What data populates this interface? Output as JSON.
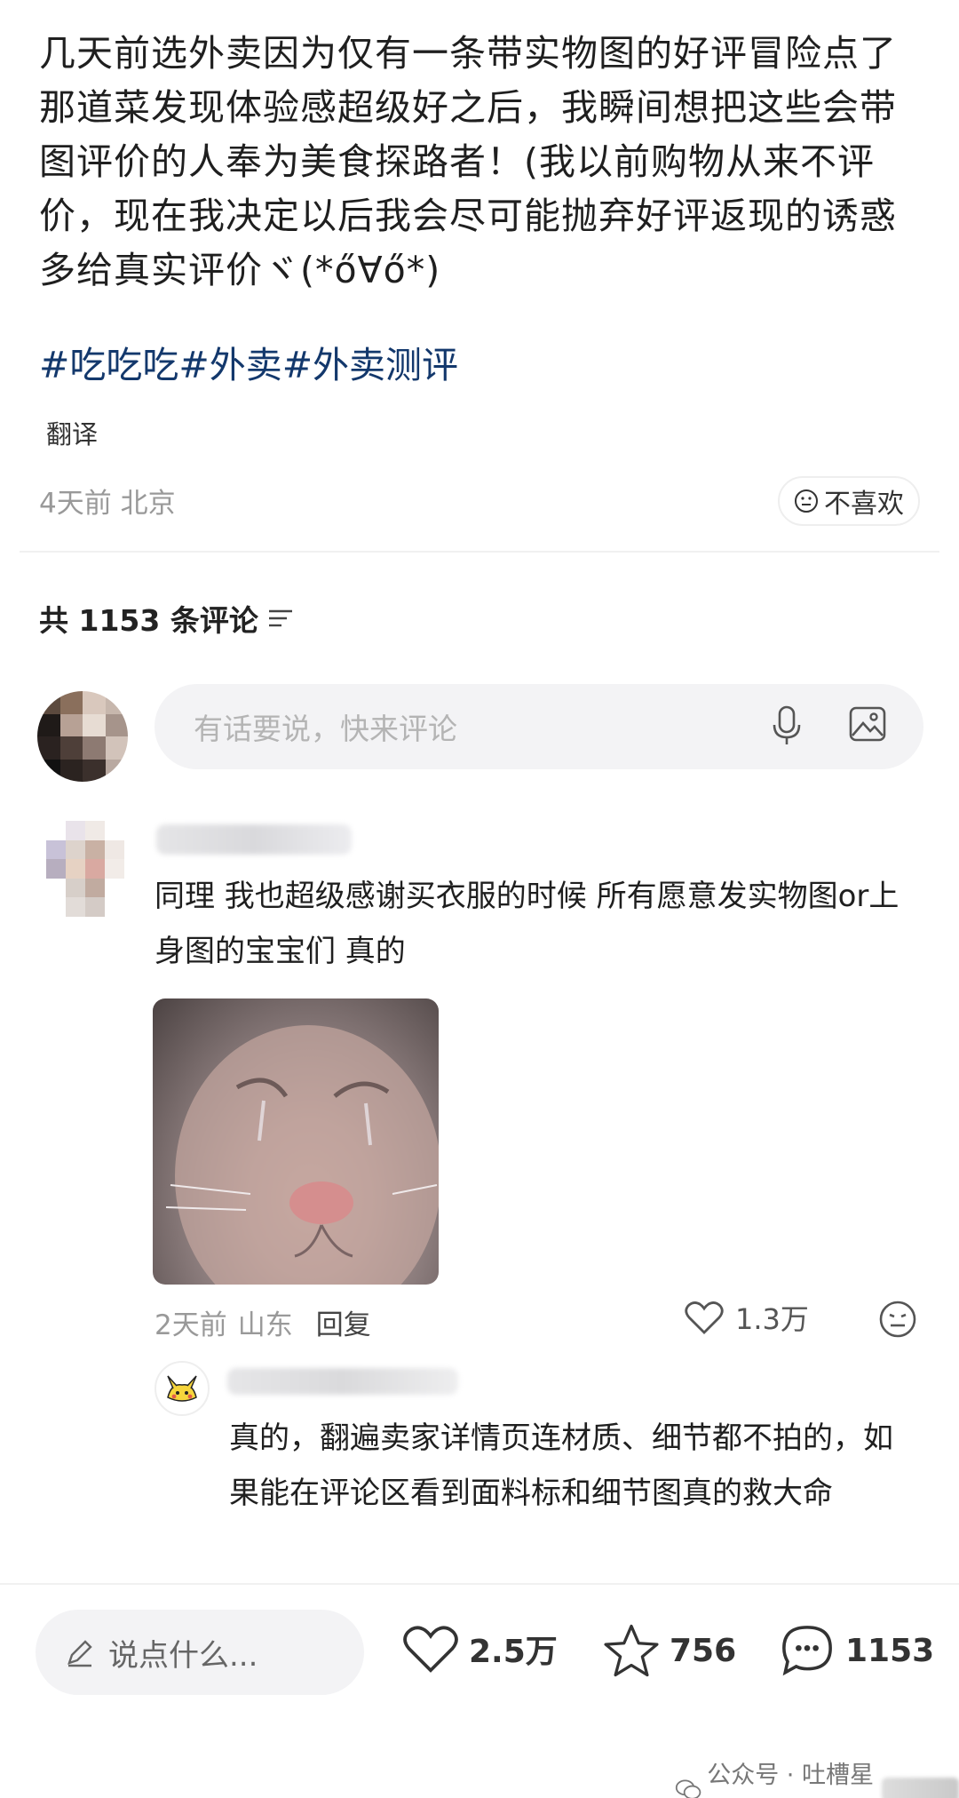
{
  "post": {
    "body": "几天前选外卖因为仅有一条带实物图的好评冒险点了那道菜发现体验感超级好之后，我瞬间想把这些会带图评价的人奉为美食探路者！(我以前购物从来不评价，现在我决定以后我会尽可能抛弃好评返现的诱惑多给真实评价ヾ(*ő∀ő*)",
    "hashtags": "#吃吃吃#外卖#外卖测评",
    "translate_label": "翻译",
    "meta": "4天前 北京",
    "dislike_label": "不喜欢"
  },
  "comments_header": {
    "count_text": "共 1153 条评论",
    "filter_icon": "filter-lines-icon"
  },
  "comment_input": {
    "placeholder": "有话要说，快来评论"
  },
  "comment": {
    "text": "同理 我也超级感谢买衣服的时候 所有愿意发实物图or上身图的宝宝们 真的",
    "image_alt": "crying cat",
    "time": "2天前",
    "location": "山东",
    "reply_label": "回复",
    "likes": "1.3万"
  },
  "reply": {
    "text": "真的，翻遍卖家详情页连材质、细节都不拍的，如果能在评论区看到面料标和细节图真的救大命"
  },
  "bottom_bar": {
    "say_placeholder": "说点什么...",
    "likes": "2.5万",
    "favorites": "756",
    "comments": "1153"
  },
  "watermark": {
    "text": "公众号 · 吐槽星君"
  },
  "colors": {
    "hashtag": "#13386c",
    "meta_gray": "#999999",
    "input_bg": "#f3f3f5"
  }
}
